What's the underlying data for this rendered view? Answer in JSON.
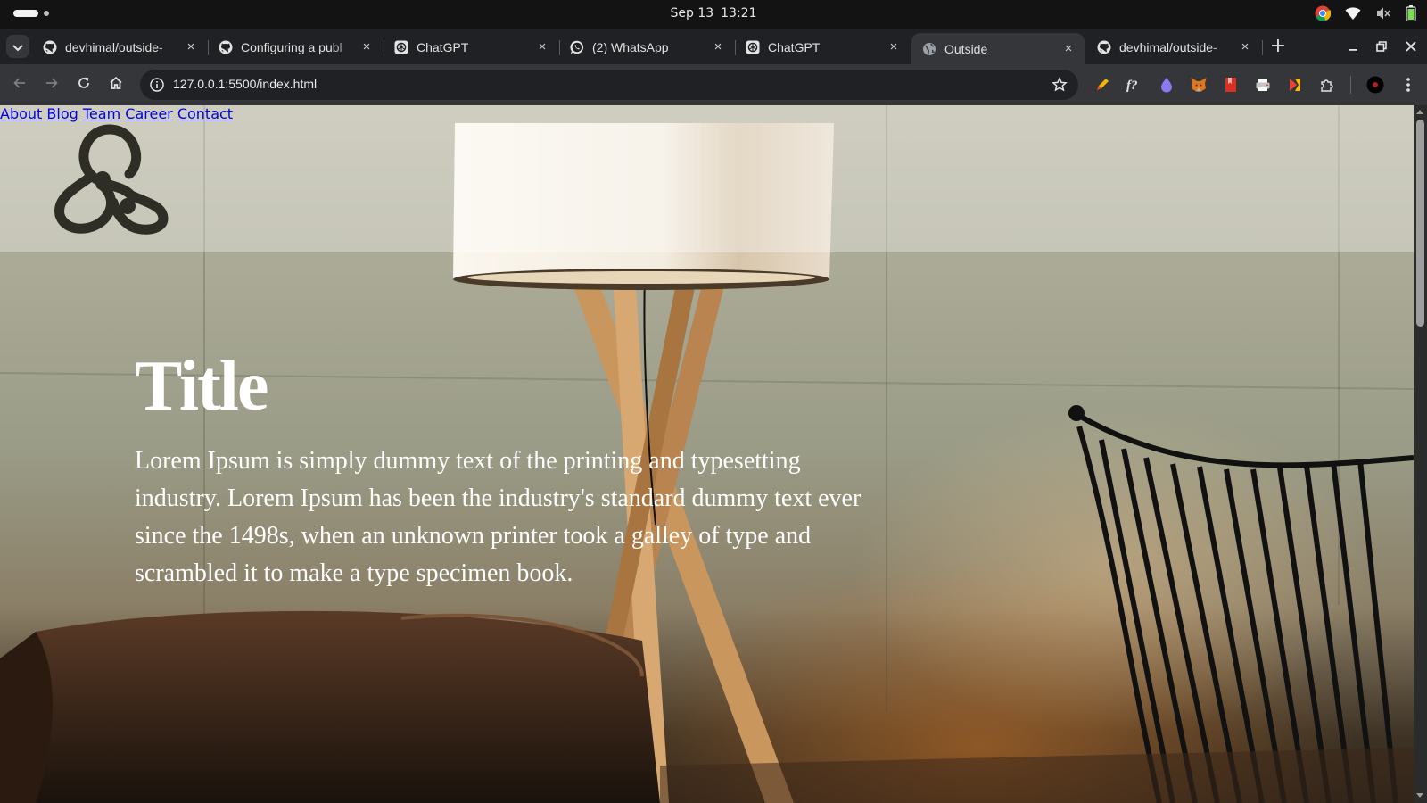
{
  "os": {
    "date": "Sep 13",
    "time": "13:21",
    "tray_icons": [
      "chrome-icon",
      "wifi-icon",
      "volume-muted-icon",
      "battery-icon"
    ]
  },
  "browser": {
    "tabs": [
      {
        "title": "devhimal/outside-",
        "favicon": "github-icon",
        "active": false
      },
      {
        "title": "Configuring a publ",
        "favicon": "github-icon",
        "active": false
      },
      {
        "title": "ChatGPT",
        "favicon": "chatgpt-icon",
        "active": false
      },
      {
        "title": "(2) WhatsApp",
        "favicon": "whatsapp-icon",
        "active": false
      },
      {
        "title": "ChatGPT",
        "favicon": "chatgpt-icon",
        "active": false
      },
      {
        "title": "Outside",
        "favicon": "globe-icon",
        "active": true
      },
      {
        "title": "devhimal/outside-",
        "favicon": "github-icon",
        "active": false
      }
    ],
    "new_tab_label": "+",
    "url": "127.0.0.1:5500/index.html",
    "close_glyph": "×"
  },
  "page": {
    "nav": [
      {
        "label": "About"
      },
      {
        "label": "Blog"
      },
      {
        "label": "Team"
      },
      {
        "label": "Career"
      },
      {
        "label": "Contact"
      }
    ],
    "hero": {
      "title": "Title",
      "text": "Lorem Ipsum is simply dummy text of the printing and typesetting industry. Lorem Ipsum has been the industry's standard dummy text ever since the 1498s, when an unknown printer took a galley of type and scrambled it to make a type specimen book."
    }
  },
  "colors": {
    "tab_bar": "#202124",
    "toolbar": "#35363a",
    "nav_text": "#3d3c34",
    "hero_text": "#ffffff"
  }
}
